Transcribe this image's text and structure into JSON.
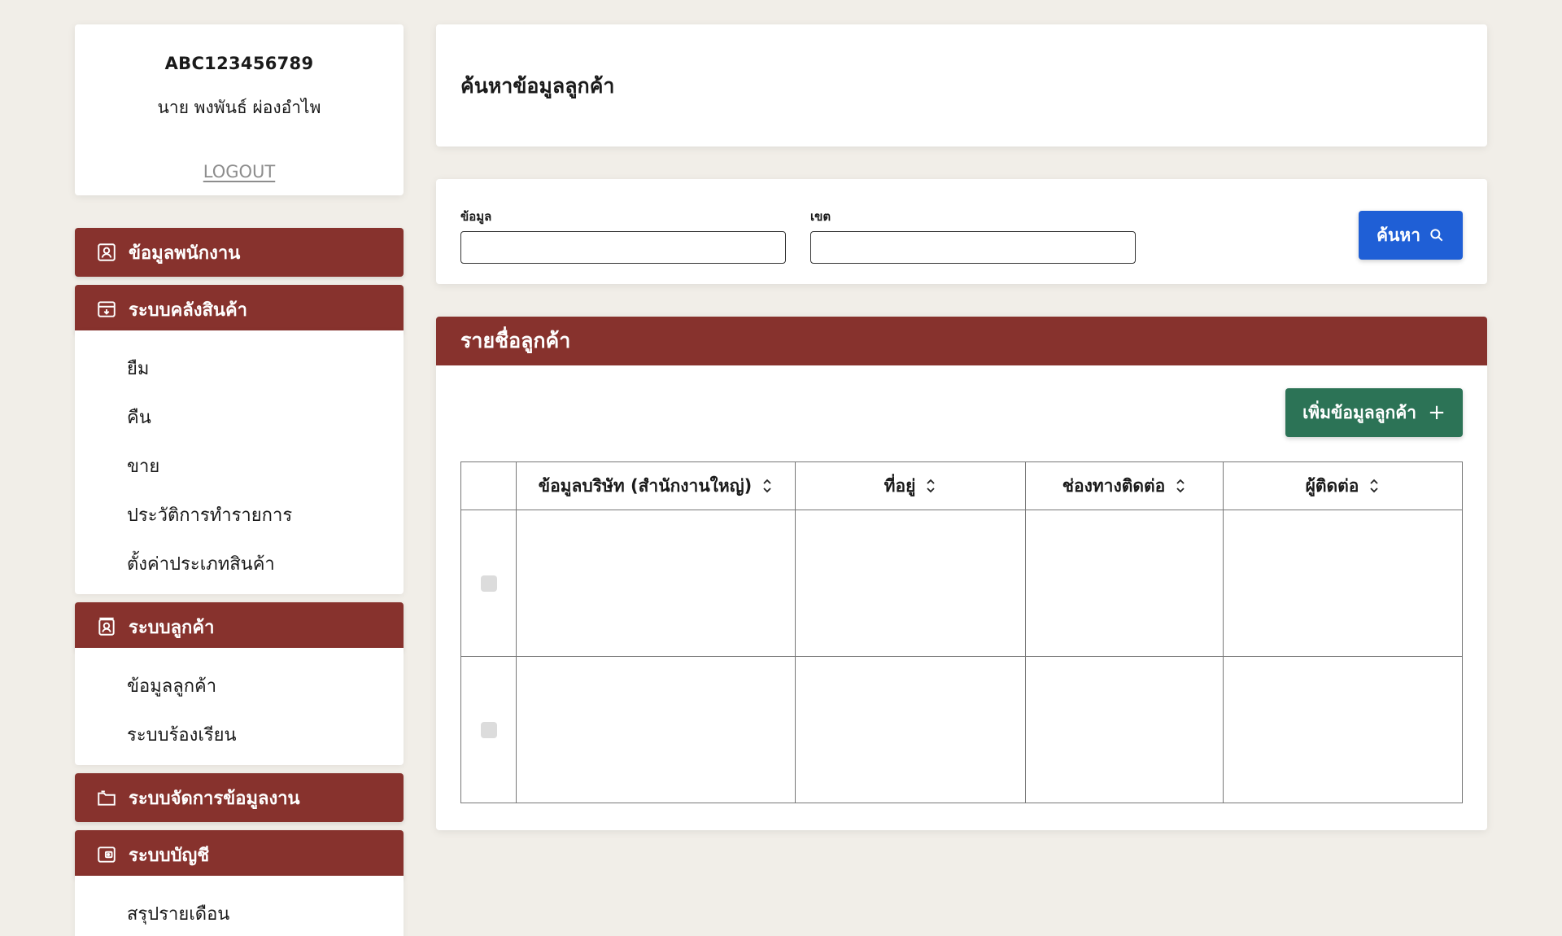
{
  "profile": {
    "code": "ABC123456789",
    "name": "นาย พงพันธ์ ผ่องอำไพ",
    "logout": "LOGOUT"
  },
  "sidebar": {
    "employee": {
      "label": "ข้อมูลพนักงาน",
      "icon": "id-card-icon"
    },
    "warehouse": {
      "label": "ระบบคลังสินค้า",
      "icon": "archive-box-icon",
      "items": [
        "ยืม",
        "คืน",
        "ขาย",
        "ประวัติการทำรายการ",
        "ตั้งค่าประเภทสินค้า"
      ]
    },
    "customer": {
      "label": "ระบบลูกค้า",
      "icon": "contact-card-icon",
      "items": [
        "ข้อมูลลูกค้า",
        "ระบบร้องเรียน"
      ]
    },
    "documents": {
      "label": "ระบบจัดการข้อมูลงาน",
      "icon": "folder-icon"
    },
    "accounting": {
      "label": "ระบบบัญชี",
      "icon": "wallet-icon",
      "items": [
        "สรุปรายเดือน"
      ]
    }
  },
  "main": {
    "title": "ค้นหาข้อมูลลูกค้า",
    "search": {
      "field1_label": "ข้อมูล",
      "field1_value": "",
      "field2_label": "เขต",
      "field2_value": "",
      "button_label": "ค้นหา"
    },
    "list": {
      "title": "รายชื่อลูกค้า",
      "add_button": "เพิ่มข้อมูลลูกค้า",
      "columns": [
        "ข้อมูลบริษัท (สำนักงานใหญ่)",
        "ที่อยู่",
        "ช่องทางติดต่อ",
        "ผู้ติดต่อ"
      ],
      "rows": [
        [
          "",
          "",
          "",
          ""
        ],
        [
          "",
          "",
          "",
          ""
        ]
      ]
    }
  },
  "colors": {
    "background": "#f1eee8",
    "primary_red": "#87322d",
    "search_blue": "#1f5fd6",
    "add_green": "#2c7356"
  }
}
